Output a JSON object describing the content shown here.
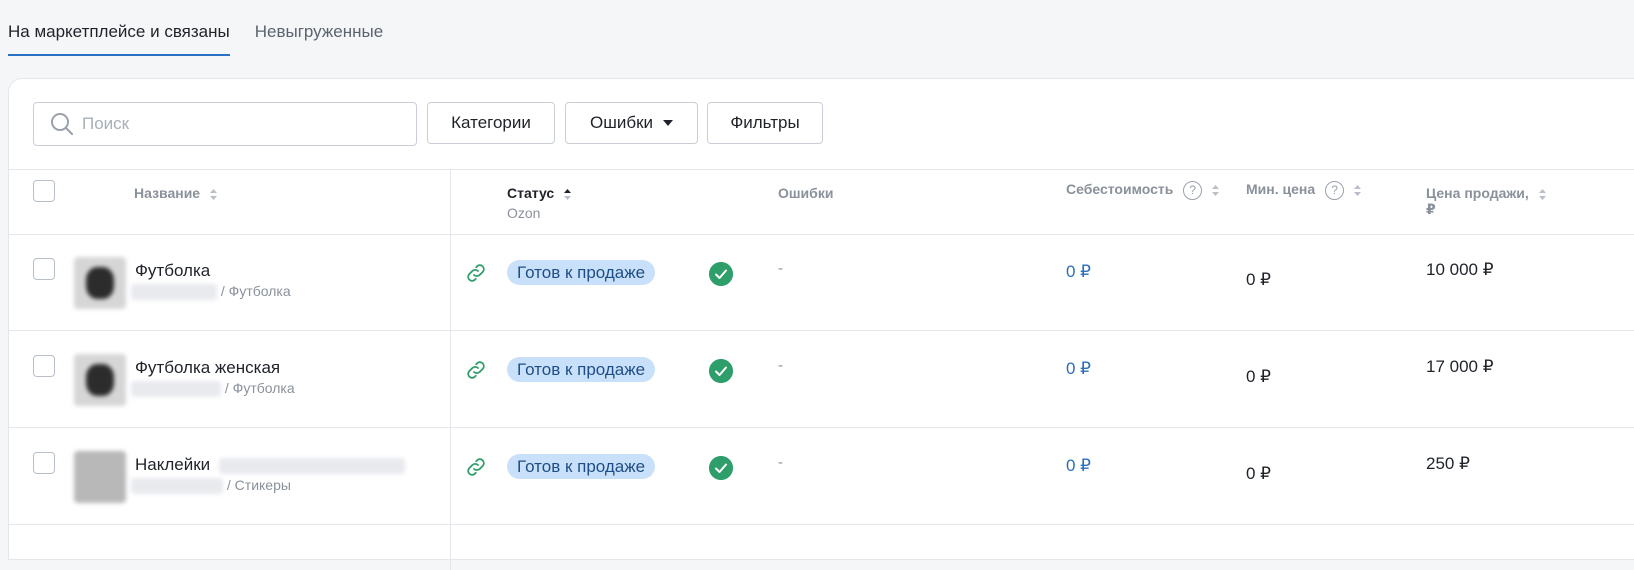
{
  "tabs": [
    {
      "label": "На маркетплейсе и связаны",
      "active": true
    },
    {
      "label": "Невыгруженные",
      "active": false
    }
  ],
  "toolbar": {
    "search_placeholder": "Поиск",
    "search_value": "",
    "categories_label": "Категории",
    "errors_label": "Ошибки",
    "filters_label": "Фильтры"
  },
  "table": {
    "headers": {
      "name": "Название",
      "status": "Статус",
      "status_sub": "Ozon",
      "errors": "Ошибки",
      "cost": "Себестоимость",
      "min_price": "Мин. цена",
      "sale_price": "Цена продажи,",
      "sale_price_unit": "₽"
    },
    "rows": [
      {
        "name": "Футболка",
        "category": "/ Футболка",
        "status": "Готов к продаже",
        "errors": "-",
        "cost": "0 ₽",
        "min_price": "0 ₽",
        "sale_price": "10 000 ₽"
      },
      {
        "name": "Футболка женская",
        "category": "/ Футболка",
        "status": "Готов к продаже",
        "errors": "-",
        "cost": "0 ₽",
        "min_price": "0 ₽",
        "sale_price": "17 000 ₽"
      },
      {
        "name": "Наклейки",
        "category": "/ Стикеры",
        "status": "Готов к продаже",
        "errors": "-",
        "cost": "0 ₽",
        "min_price": "0 ₽",
        "sale_price": "250 ₽"
      }
    ]
  },
  "colors": {
    "accent": "#2a72c4",
    "badge_bg": "#c9e0fa",
    "success": "#2e9e6a",
    "link_icon": "#2e9e6a"
  }
}
